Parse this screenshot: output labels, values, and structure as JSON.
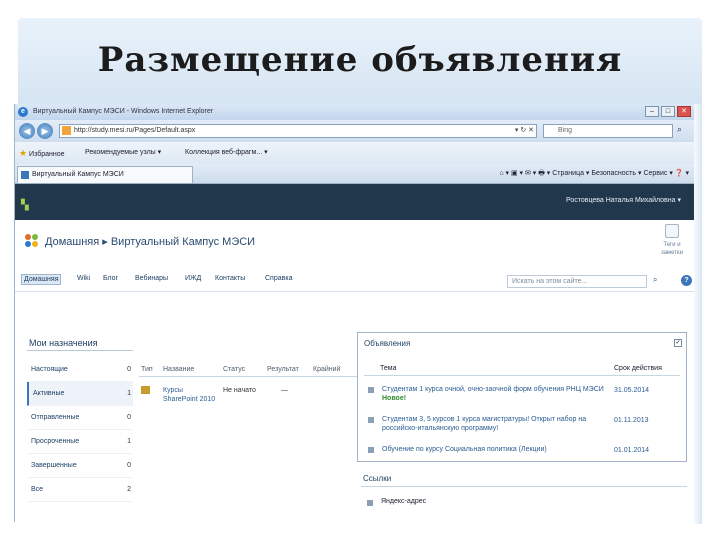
{
  "slide": {
    "title": "Размещение объявления"
  },
  "ie": {
    "window_title": "Виртуальный Кампус МЭСИ - Windows Internet Explorer",
    "win_min": "–",
    "win_max": "□",
    "win_close": "✕",
    "back_glyph": "◀",
    "forward_glyph": "▶",
    "address": "http://study.mesi.ru/Pages/Default.aspx",
    "address_tools": "▾ ↻ ✕",
    "search_placeholder": "Bing",
    "favorites_label": "Избранное",
    "fav_suggested": "Рекомендуемые узлы ▾",
    "fav_gallery": "Коллекция веб-фрагм... ▾",
    "tab_label": "Виртуальный Кампус МЭСИ",
    "cmd_bar": "⌂ ▾ ▣ ▾ ✉ ▾ 🖶 ▾  Страница ▾  Безопасность ▾  Сервис ▾  ❓ ▾"
  },
  "sp": {
    "user": "Ростовцева Наталья Михайловна ▾",
    "breadcrumb_home": "Домашняя",
    "breadcrumb_sep": "▸",
    "breadcrumb_site": "Виртуальный Кампус МЭСИ",
    "tags_label": "Теги и\nзаметки",
    "nav": [
      "Домашняя",
      "Wiki",
      "Блог",
      "Вебинары",
      "ИЖД",
      "Контакты",
      "Справка"
    ],
    "search_placeholder": "Искать на этом сайте...",
    "help": "?"
  },
  "assignments": {
    "title": "Мои назначения",
    "categories": [
      {
        "label": "Настоящие",
        "count": "0"
      },
      {
        "label": "Активные",
        "count": "1"
      },
      {
        "label": "Отправленные",
        "count": "0"
      },
      {
        "label": "Просроченные",
        "count": "1"
      },
      {
        "label": "Завершенные",
        "count": "0"
      },
      {
        "label": "Все",
        "count": "2"
      }
    ],
    "columns": [
      "Тип",
      "Название",
      "Статус",
      "Результат",
      "Крайний"
    ],
    "row": {
      "title": "Курсы SharePoint 2010",
      "status": "Не начато",
      "result": "—"
    }
  },
  "announcements": {
    "title": "Объявления",
    "col_title": "Тема",
    "col_date": "Срок действия",
    "rows": [
      {
        "text": "Студентам 1 курса очной, очно-заочной форм обучения РНЦ МЭСИ",
        "badge": "Новое!",
        "date": "31.05.2014"
      },
      {
        "text": "Студентам 3, 5 курсов 1 курса магистратуры! Открыт набор на российско-итальянскую программу!",
        "badge": "",
        "date": "01.11.2013"
      },
      {
        "text": "Обучение по курсу Социальная политика (Лекции)",
        "badge": "",
        "date": "01.01.2014"
      }
    ]
  },
  "links": {
    "title": "Ссылки",
    "item": "Яндекс-адрес"
  }
}
